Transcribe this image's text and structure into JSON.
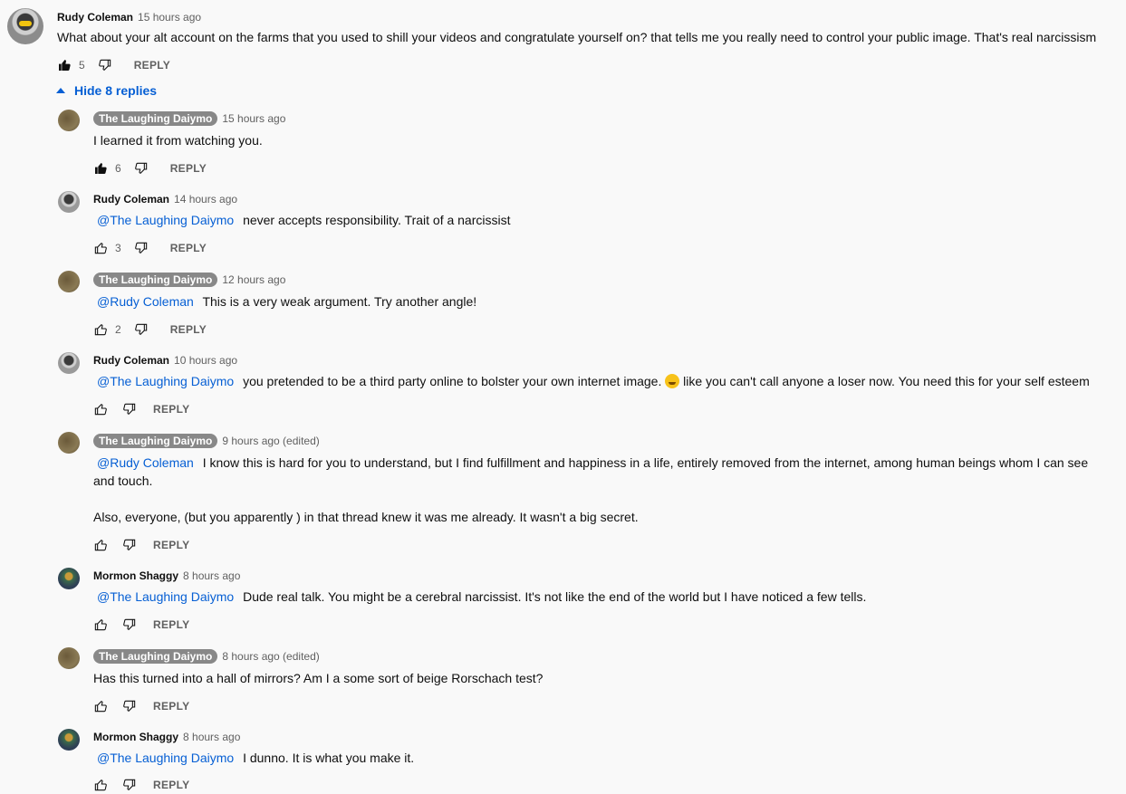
{
  "top": {
    "author": "Rudy Coleman",
    "time": "15 hours ago",
    "text": "What about your alt account on the farms that you used to shill your videos and congratulate yourself on?  that tells me you really need to control your public image. That's real narcissism",
    "likes": "5",
    "reply": "REPLY"
  },
  "hide_replies": "Hide 8 replies",
  "replies": [
    {
      "author": "The Laughing Daiymo",
      "time": "15 hours ago",
      "mention": "",
      "text": "I learned it from watching you.",
      "likes": "6",
      "reply": "REPLY"
    },
    {
      "author": "Rudy Coleman",
      "time": "14 hours ago",
      "mention": "@The Laughing Daiymo",
      "text": "never accepts responsibility. Trait of a narcissist",
      "likes": "3",
      "reply": "REPLY"
    },
    {
      "author": "The Laughing Daiymo",
      "time": "12 hours ago",
      "mention": "@Rudy Coleman",
      "text": "This is a very weak argument. Try another angle!",
      "likes": "2",
      "reply": "REPLY"
    },
    {
      "author": "Rudy Coleman",
      "time": "10 hours ago",
      "mention": "@The Laughing Daiymo",
      "text": "you pretended to be a third party online to bolster your own internet image.",
      "text2": "like you can't call anyone a loser now. You need this for your self esteem",
      "likes": "",
      "reply": "REPLY"
    },
    {
      "author": "The Laughing Daiymo",
      "time": "9 hours ago (edited)",
      "mention": "@Rudy Coleman",
      "text": "I know this is hard for you to understand, but I find fulfillment and happiness in a life, entirely removed from the internet, among human beings whom I can see and touch.",
      "text2": "Also, everyone, (but you apparently ) in that thread knew it was me already. It wasn't a big secret.",
      "likes": "",
      "reply": "REPLY"
    },
    {
      "author": "Mormon Shaggy",
      "time": "8 hours ago",
      "mention": "@The Laughing Daiymo",
      "text": "Dude real talk. You might be a cerebral narcissist. It's not like the end of the world but I have noticed a few tells.",
      "likes": "",
      "reply": "REPLY"
    },
    {
      "author": "The Laughing Daiymo",
      "time": "8 hours ago (edited)",
      "mention": "",
      "text": "Has this turned into a hall of mirrors? Am I a some sort of beige Rorschach test?",
      "likes": "",
      "reply": "REPLY"
    },
    {
      "author": "Mormon Shaggy",
      "time": "8 hours ago",
      "mention": "@The Laughing Daiymo",
      "text": "I dunno. It is what you make it.",
      "likes": "",
      "reply": "REPLY"
    }
  ]
}
